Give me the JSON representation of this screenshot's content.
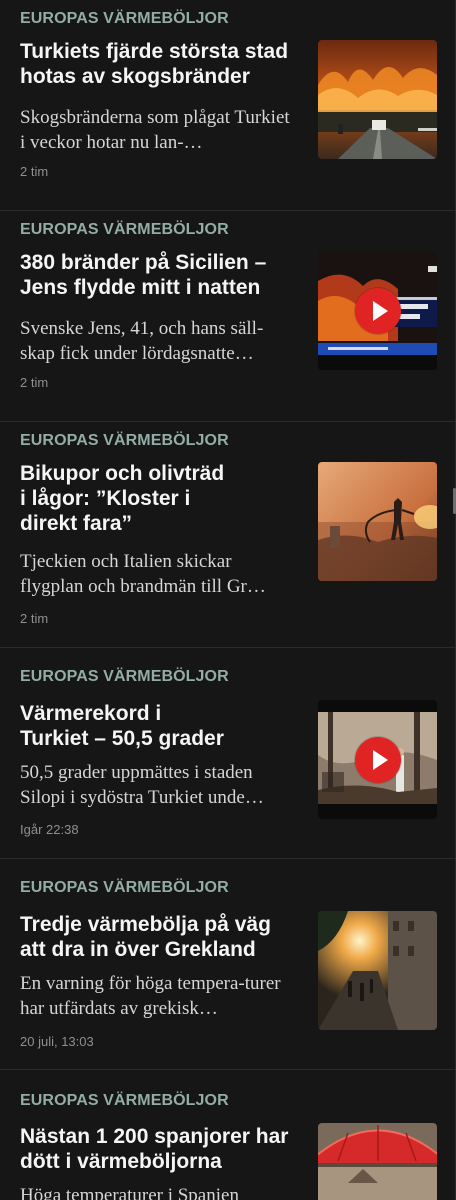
{
  "accent_colors": {
    "topic": "#94aca6",
    "play_button": "#e02424",
    "background": "#161616"
  },
  "articles": [
    {
      "topic": "EUROPAS VÄRMEBÖLJOR",
      "headline": "Turkiets fjärde största stad hotas av skogsbränder",
      "summary": "Skogsbränderna som plågat Turkiet i veckor hotar nu lan-…",
      "time": "2 tim",
      "thumbnail": "wildfire-road-photo",
      "video": false
    },
    {
      "topic": "EUROPAS VÄRMEBÖLJOR",
      "headline": "380 bränder på Sicilien – Jens flydde mitt i natten",
      "summary": "Svenske Jens, 41, och hans säll-skap fick under lördagsnatte…",
      "time": "2 tim",
      "thumbnail": "sicily-news-broadcast-photo",
      "video": true
    },
    {
      "topic": "EUROPAS VÄRMEBÖLJOR",
      "headline": "Bikupor och olivträd i lågor: ”Kloster i direkt fara”",
      "summary": "Tjeckien och Italien skickar flygplan och brandmän till Gr…",
      "time": "2 tim",
      "thumbnail": "firefighter-hose-photo",
      "video": false
    },
    {
      "topic": "EUROPAS VÄRMEBÖLJOR",
      "headline": "Värmerekord i Turkiet – 50,5 grader",
      "summary": "50,5 grader uppmättes i staden Silopi i sydöstra Turkiet unde…",
      "time": "Igår 22:38",
      "thumbnail": "smoky-forest-video-photo",
      "video": true
    },
    {
      "topic": "EUROPAS VÄRMEBÖLJOR",
      "headline": "Tredje värmebölja på väg att dra in över Grekland",
      "summary": "En varning för höga tempera-turer har utfärdats av grekisk…",
      "time": "20 juli, 13:03",
      "thumbnail": "sunset-street-photo",
      "video": false
    },
    {
      "topic": "EUROPAS VÄRMEBÖLJOR",
      "headline": "Nästan 1 200 spanjorer har dött i värmeböljorna",
      "summary": "Höga temperaturer i Spanien",
      "time": "",
      "thumbnail": "red-parasol-photo",
      "video": false
    }
  ]
}
